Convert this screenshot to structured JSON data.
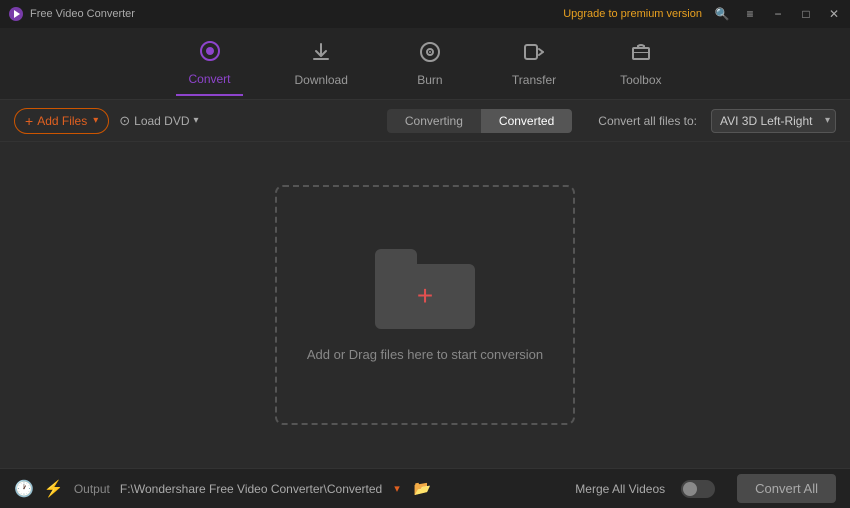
{
  "titleBar": {
    "appTitle": "Free Video Converter",
    "upgradeText": "Upgrade to premium version",
    "minBtn": "−",
    "maxBtn": "□",
    "closeBtn": "✕"
  },
  "nav": {
    "items": [
      {
        "id": "convert",
        "label": "Convert",
        "icon": "⊙",
        "active": true
      },
      {
        "id": "download",
        "label": "Download",
        "icon": "⬇",
        "active": false
      },
      {
        "id": "burn",
        "label": "Burn",
        "icon": "⊕",
        "active": false
      },
      {
        "id": "transfer",
        "label": "Transfer",
        "icon": "⇄",
        "active": false
      },
      {
        "id": "toolbox",
        "label": "Toolbox",
        "icon": "≡",
        "active": false
      }
    ]
  },
  "toolbar": {
    "addFilesLabel": "Add Files",
    "loadDvdLabel": "Load DVD",
    "tabs": [
      {
        "id": "converting",
        "label": "Converting",
        "active": false
      },
      {
        "id": "converted",
        "label": "Converted",
        "active": true
      }
    ],
    "convertAllLabel": "Convert all files to:",
    "formatValue": "AVI 3D Left-Right"
  },
  "dropZone": {
    "hintText": "Add or Drag files here to start conversion"
  },
  "statusBar": {
    "outputLabel": "Output",
    "outputPath": "F:\\Wondershare Free Video Converter\\Converted",
    "mergeLabel": "Merge All Videos",
    "convertAllBtnLabel": "Convert All"
  }
}
